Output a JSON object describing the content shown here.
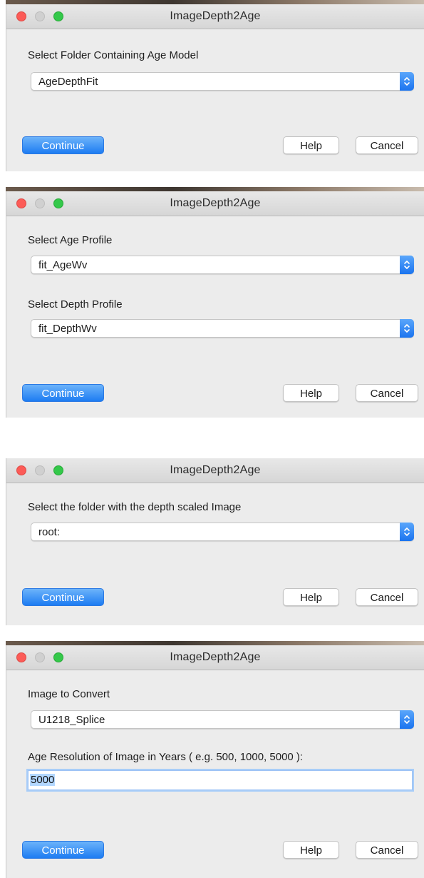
{
  "app_title": "ImageDepth2Age",
  "buttons": {
    "continue": "Continue",
    "help": "Help",
    "cancel": "Cancel"
  },
  "dialog1": {
    "prompt": "Select Folder Containing Age Model",
    "popup_value": "AgeDepthFit"
  },
  "dialog2": {
    "age_prompt": "Select Age Profile",
    "age_value": "fit_AgeWv",
    "depth_prompt": "Select Depth Profile",
    "depth_value": "fit_DepthWv"
  },
  "dialog3": {
    "prompt": "Select the folder with the depth scaled Image",
    "popup_value": "root:"
  },
  "dialog4": {
    "image_prompt": "Image to Convert",
    "image_value": "U1218_Splice",
    "resolution_prompt": "Age Resolution of Image in Years ( e.g. 500, 1000, 5000 ):",
    "resolution_value": "5000"
  },
  "colors": {
    "accent": "#1d7cf2",
    "close": "#fc5b57",
    "maximize": "#34c84a",
    "window_bg": "#ececec"
  },
  "icons": [
    "close-icon",
    "minimize-icon",
    "zoom-icon",
    "popup-arrows-icon"
  ]
}
